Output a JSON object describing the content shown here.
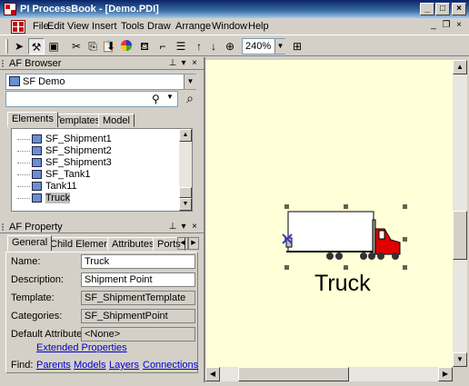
{
  "window": {
    "title": "PI ProcessBook - [Demo.PDI]"
  },
  "menu": [
    "File",
    "Edit",
    "View",
    "Insert",
    "Tools",
    "Draw",
    "Arrange",
    "Window",
    "Help"
  ],
  "toolbar": {
    "zoom": "240%"
  },
  "af_browser": {
    "title": "AF Browser",
    "server": "SF Demo",
    "search_value": "",
    "tabs": [
      "Elements",
      "Templates",
      "Model"
    ],
    "tree": [
      "SF_Shipment1",
      "SF_Shipment2",
      "SF_Shipment3",
      "SF_Tank1",
      "Tank11",
      "Truck"
    ],
    "selected": "Truck"
  },
  "af_property": {
    "title": "AF Property",
    "tabs": [
      "General",
      "Child Elements",
      "Attributes",
      "Ports"
    ],
    "fields": [
      {
        "label": "Name:",
        "value": "Truck"
      },
      {
        "label": "Description:",
        "value": "Shipment Point"
      },
      {
        "label": "Template:",
        "value": "SF_ShipmentTemplate"
      },
      {
        "label": "Categories:",
        "value": "SF_ShipmentPoint"
      },
      {
        "label": "Default Attribute:",
        "value": "<None>"
      }
    ],
    "extended_link": "Extended Properties",
    "find_label": "Find:",
    "find_links": [
      "Parents",
      "Models",
      "Layers",
      "Connections"
    ]
  },
  "canvas": {
    "symbol_label": "Truck"
  },
  "colors": {
    "canvas_bg": "#ffffd8",
    "title_blue": "#0a246a",
    "truck_cab": "#e00000"
  }
}
